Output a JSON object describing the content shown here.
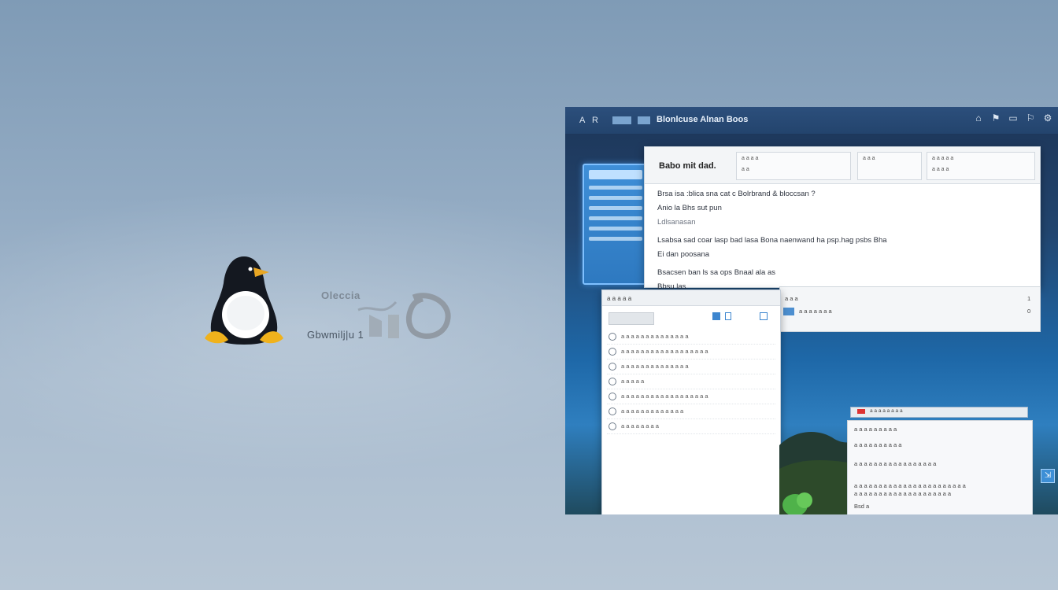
{
  "logo": {
    "wordmark": "Oleccia",
    "caption": "Gbwmilj|u 1"
  },
  "topbar": {
    "left_item_1": "A",
    "left_item_2": "R",
    "title": "Blonlcuse Alnan Boos",
    "right_icons": [
      "lock-icon",
      "notification-icon",
      "battery-icon",
      "flag-icon",
      "gear-icon"
    ]
  },
  "document": {
    "heading": "Babo mit dad.",
    "toolbar": {
      "group1": [
        "a a a a",
        "a a"
      ],
      "group2": [
        "a a a"
      ],
      "group3": [
        "a a a a a",
        "a a a a"
      ]
    },
    "lines": [
      "Brsa isa  :blica sna cat c Bolrbrand & bloccsan ?",
      "Anio la  Bhs sut pun",
      "Ldlsanasan",
      "Lsabsa sad coar lasp bad lasa Bona naenwand ha psp.hag psbs Bha",
      "Ei dan poosana",
      "Bsacsen ban ls sa ops Bnaal ala as",
      "Bbsu las."
    ]
  },
  "files": {
    "title": "a a a a a",
    "rows": [
      {
        "text": "a a a a a a a a a a a a a a"
      },
      {
        "text": "a a a a a a a a a a a a a a a a a a"
      },
      {
        "text": "a a a a a a a a a a a a a a"
      },
      {
        "text": "a a a a a"
      },
      {
        "text": "a a a a a a a a a a a a a a a a a a"
      },
      {
        "text": "a a a a a a a a a a a a a"
      },
      {
        "text": "a a a a a a a a"
      }
    ]
  },
  "strip": {
    "row1": "a a a",
    "row2": "a a a a a a a",
    "num1": "1",
    "num2": "0"
  },
  "notification": {
    "bar": "a a a a a a a a",
    "lines": [
      "a a a a a a a a a",
      "a a a a a a a a a a",
      "a a a a a a a a a a a a a a a a a",
      "a a a a a a a a a a a a a a a a a a a a a a a",
      "a a a a a a a a a a a a a a a a a a a a",
      "Bsd   a"
    ]
  },
  "colors": {
    "wallpaper_top": "#7f9bb6",
    "wallpaper_bottom": "#b7c6d5",
    "screen_accent": "#1e68a8"
  }
}
